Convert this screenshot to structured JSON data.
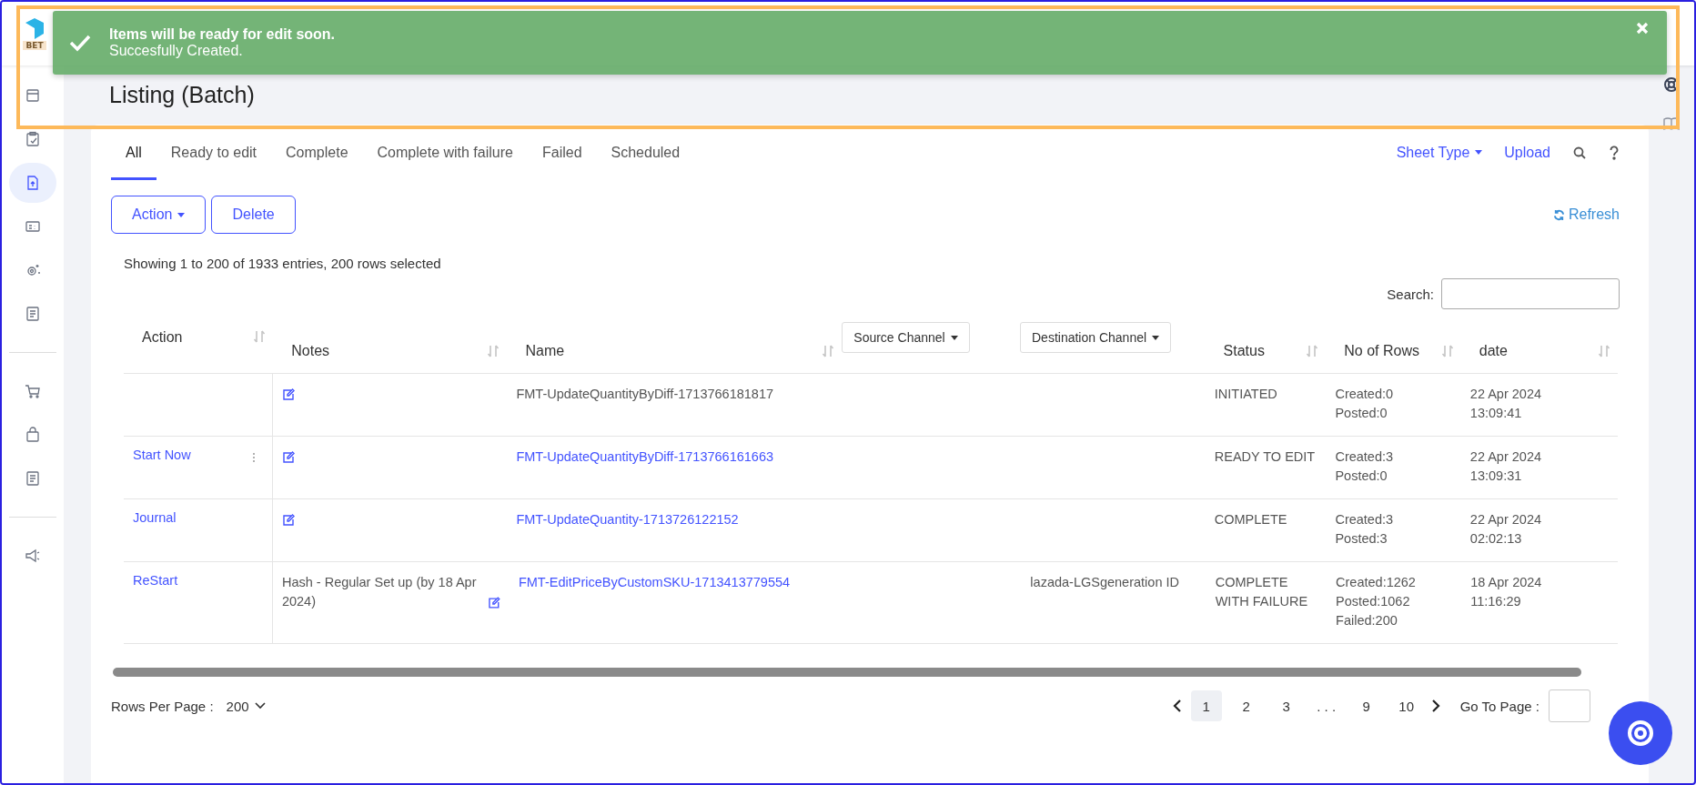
{
  "top_nav": {
    "logo_text": "BET"
  },
  "toast": {
    "title": "Items will be ready for edit soon.",
    "message": "Succesfully Created."
  },
  "page_title": "Listing (Batch)",
  "sidebar": {
    "groups": [
      [
        {
          "kind": "panel",
          "selected": false
        },
        {
          "kind": "clipboard",
          "selected": false
        },
        {
          "kind": "file-upload",
          "selected": true
        },
        {
          "kind": "card",
          "selected": false
        },
        {
          "kind": "gear",
          "selected": false
        },
        {
          "kind": "document",
          "selected": false
        }
      ],
      [
        {
          "kind": "cart",
          "selected": false
        },
        {
          "kind": "bag",
          "selected": false
        },
        {
          "kind": "document",
          "selected": false
        }
      ],
      [
        {
          "kind": "megaphone",
          "selected": false
        }
      ]
    ]
  },
  "tabs": [
    {
      "label": "All",
      "selected": true
    },
    {
      "label": "Ready to edit",
      "selected": false
    },
    {
      "label": "Complete",
      "selected": false
    },
    {
      "label": "Complete with failure",
      "selected": false
    },
    {
      "label": "Failed",
      "selected": false
    },
    {
      "label": "Scheduled",
      "selected": false
    }
  ],
  "sheet_type": "Sheet Type",
  "upload": "Upload",
  "buttons": [
    {
      "label": "Action",
      "dropdown": true
    },
    {
      "label": "Delete",
      "dropdown": false
    }
  ],
  "refresh": "Refresh",
  "entries_info": "Showing 1 to 200 of 1933 entries, 200 rows selected",
  "search": {
    "label": "Search:"
  },
  "table": {
    "columns": [
      {
        "label": "Action",
        "kind": "sort"
      },
      {
        "label": "Notes",
        "kind": "sort"
      },
      {
        "label": "Name",
        "kind": "sort"
      },
      {
        "label": "Source Channel",
        "kind": "dropdown"
      },
      {
        "label": "Destination Channel",
        "kind": "dropdown"
      },
      {
        "label": "Status",
        "kind": "sort"
      },
      {
        "label": "No of Rows",
        "kind": "sort"
      },
      {
        "label": "date",
        "kind": "sort"
      }
    ],
    "rows": [
      {
        "action": "",
        "menu": false,
        "notes": "",
        "name": "FMT-UpdateQuantityByDiff-1713766181817",
        "name_link": false,
        "source": "",
        "destination": "",
        "status": "INITIATED",
        "counts": [
          "Created:0",
          "Posted:0"
        ],
        "date": "22 Apr 2024",
        "time": "13:09:41"
      },
      {
        "action": "Start Now",
        "menu": true,
        "notes": "",
        "name": "FMT-UpdateQuantityByDiff-1713766161663",
        "name_link": true,
        "source": "",
        "destination": "",
        "status": "READY TO EDIT",
        "counts": [
          "Created:3",
          "Posted:0"
        ],
        "date": "22 Apr 2024",
        "time": "13:09:31"
      },
      {
        "action": "Journal",
        "menu": false,
        "notes": "",
        "name": "FMT-UpdateQuantity-1713726122152",
        "name_link": true,
        "source": "",
        "destination": "",
        "status": "COMPLETE",
        "counts": [
          "Created:3",
          "Posted:3"
        ],
        "date": "22 Apr 2024",
        "time": "02:02:13"
      },
      {
        "action": "ReStart",
        "menu": false,
        "notes": "Hash - Regular Set up (by 18 Apr 2024)",
        "name": "FMT-EditPriceByCustomSKU-1713413779554",
        "name_link": true,
        "source": "",
        "destination": "lazada-LGSgeneration ID",
        "status": "COMPLETE WITH FAILURE",
        "counts": [
          "Created:1262",
          "Posted:1062",
          "Failed:200"
        ],
        "date": "18 Apr 2024",
        "time": "11:16:29"
      }
    ]
  },
  "footer": {
    "rows_per_page_label": "Rows Per Page :",
    "rows_per_page": "200",
    "pages": [
      {
        "label": "1",
        "kind": "page",
        "selected": true
      },
      {
        "label": "2",
        "kind": "page",
        "selected": false
      },
      {
        "label": "3",
        "kind": "page",
        "selected": false
      },
      {
        "label": ". . .",
        "kind": "ellipsis"
      },
      {
        "label": "9",
        "kind": "page",
        "selected": false
      },
      {
        "label": "10",
        "kind": "page",
        "selected": false
      }
    ],
    "go_to_page_label": "Go To Page :"
  }
}
